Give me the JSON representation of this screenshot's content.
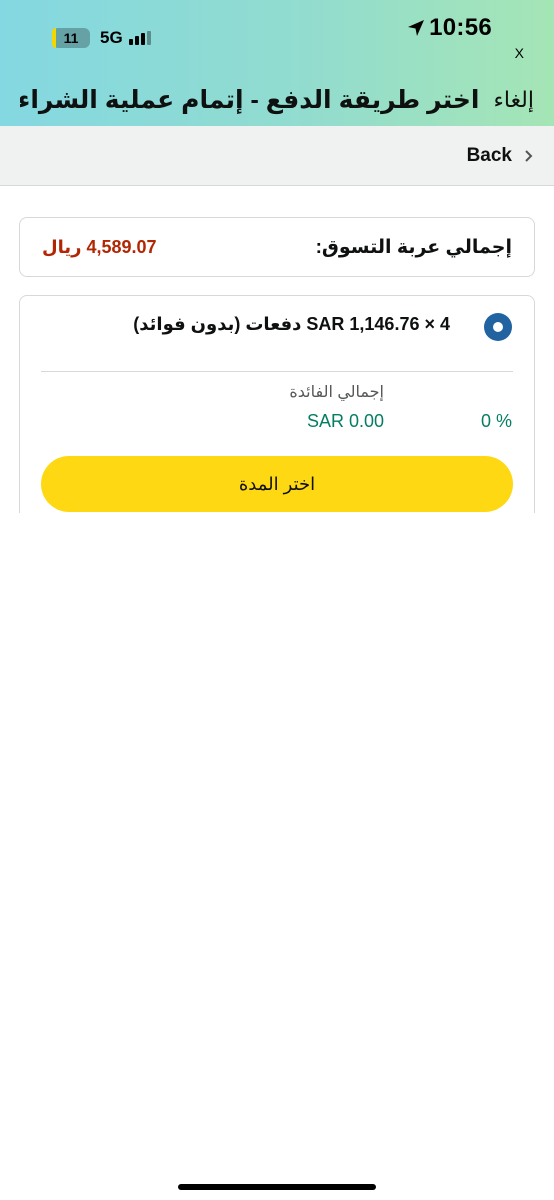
{
  "status_bar": {
    "time": "10:56",
    "battery_level": "11",
    "battery_fraction": 0.11,
    "network": "5G",
    "close_label": "X"
  },
  "header": {
    "cancel_label": "إلغاء",
    "title": "اختر طريقة الدفع - إتمام عملية الشراء..."
  },
  "nav": {
    "back_label": "Back"
  },
  "cart": {
    "label": "إجمالي عربة التسوق:",
    "value": "4,589.07 ريال"
  },
  "installment_option": {
    "label": "4 × SAR 1,146.76 دفعات (بدون فوائد)",
    "selected": true,
    "interest_label": "إجمالي الفائدة",
    "interest_rate": "0 %",
    "interest_amount": "SAR 0.00",
    "button_label": "اختر المدة"
  },
  "colors": {
    "accent_button": "#ffd814",
    "price_red": "#b12704",
    "interest_green": "#067d62",
    "radio_blue": "#2162a1"
  },
  "icons": [
    "location-arrow-icon",
    "chevron-right-icon",
    "signal-bars-icon",
    "battery-icon"
  ]
}
